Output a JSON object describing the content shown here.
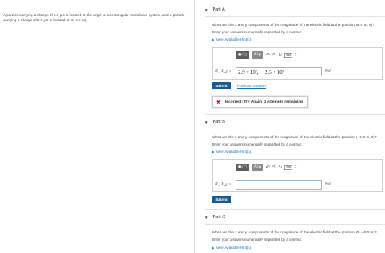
{
  "problem": {
    "text": "A particle carrying a charge of 5.0 μC is located at the origin of a rectangular coordinate system, and a particle carrying a charge of 2.0 μC is located at (0, 5.0 m)."
  },
  "toolbar": {
    "templates_label": "■√□",
    "greek_label": "AΣφ",
    "undo_glyph": "↶",
    "redo_glyph": "↷",
    "reset_glyph": "↻",
    "keyboard_label": "⌨",
    "help_glyph": "?"
  },
  "parts": [
    {
      "title": "Part A",
      "question": "What are the x and y components of the magnitude of the electric field at the position (5.0 m, 0)?",
      "instruction": "Enter your answers numerically separated by a comma.",
      "hint": "View Available Hint(s)",
      "eq_label": "Eₓ, E_y =",
      "answer": "2.9 • 10², − 2.5 • 10²",
      "units": "N/C",
      "submit": "Submit",
      "previous_answers": "Previous Answers",
      "feedback": "Incorrect; Try Again; 2 attempts remaining"
    },
    {
      "title": "Part B",
      "question": "What are the x and y components of the magnitude of the electric field at the position (−5.0 m, 0)?",
      "instruction": "Enter your answers numerically separated by a comma.",
      "hint": "View Available Hint(s)",
      "eq_label": "Eₓ, E_y =",
      "answer": "",
      "units": "N/C",
      "submit": "Submit"
    },
    {
      "title": "Part C",
      "question": "What are the x and y components of the magnitude of the electric field at the position (0, −5.0 m)?",
      "instruction": "Enter your answers numerically separated by a comma.",
      "hint": "View Available Hint(s)"
    }
  ]
}
